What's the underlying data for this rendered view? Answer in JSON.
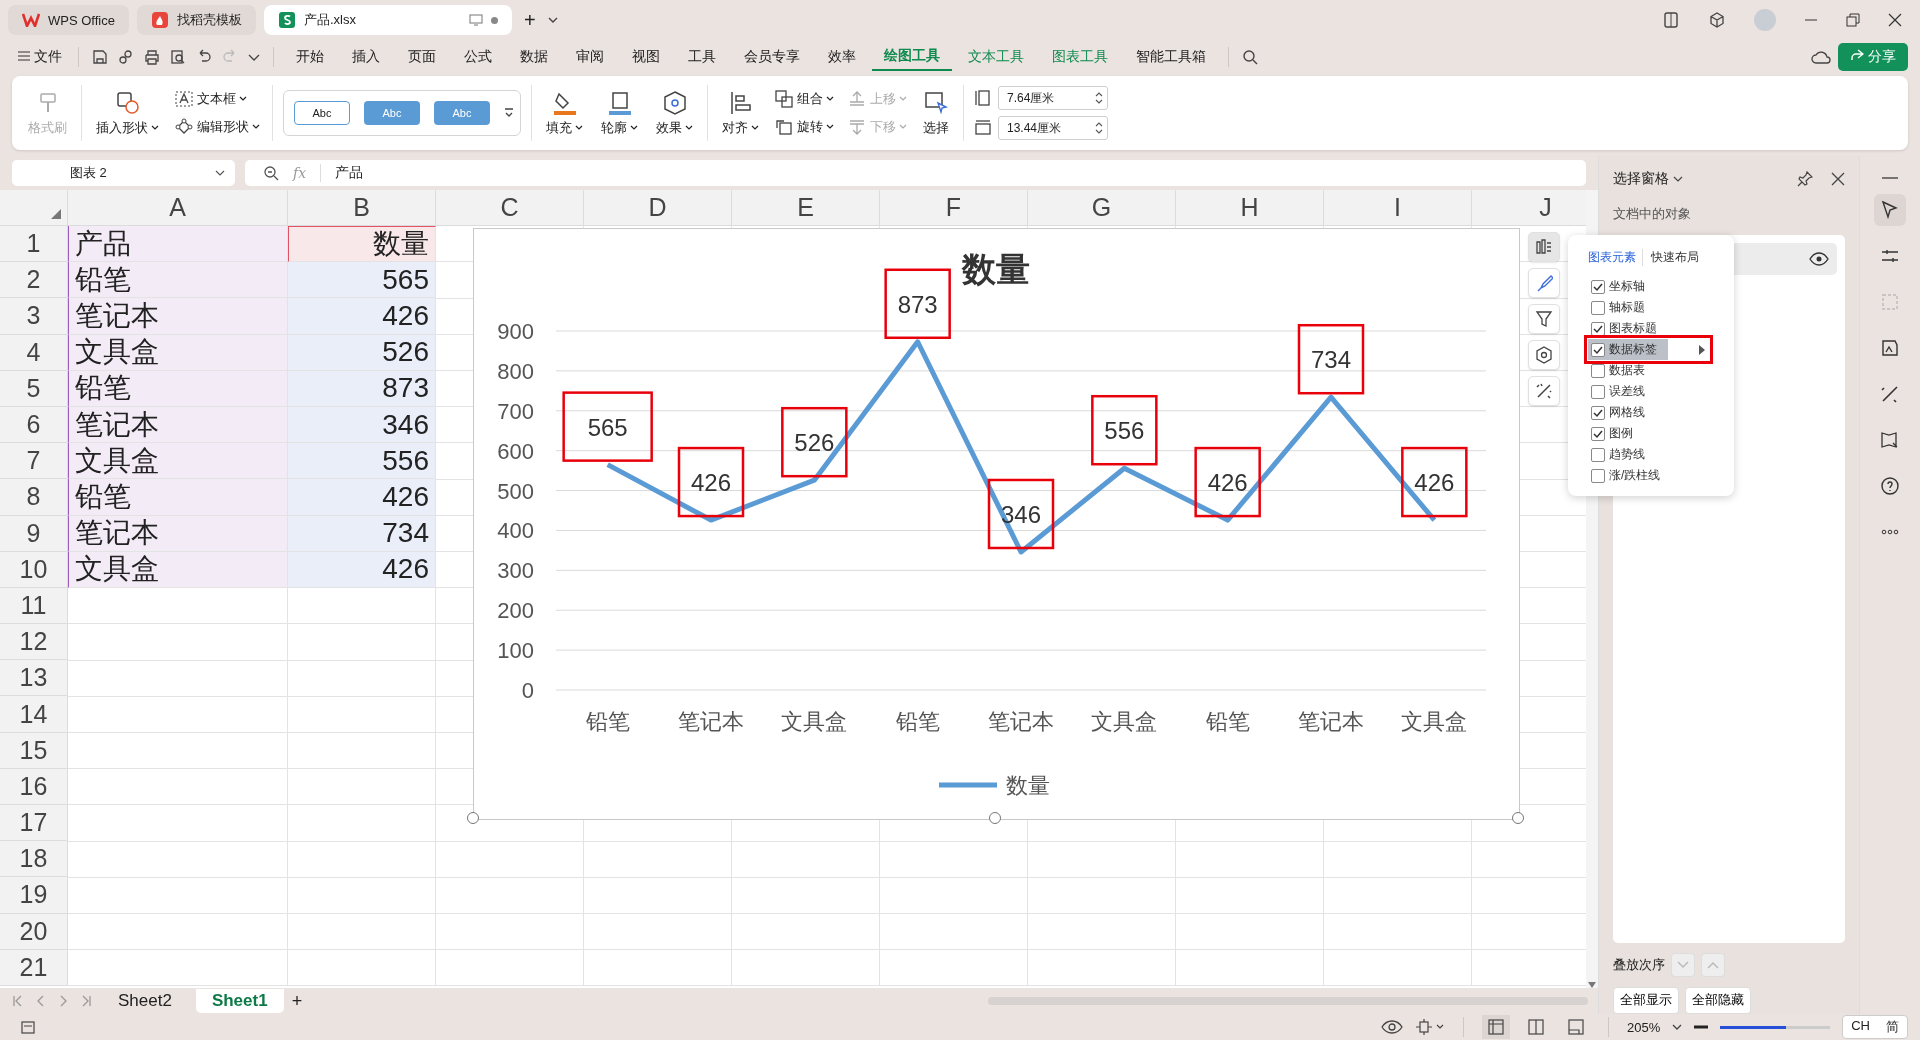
{
  "title_bar": {
    "tabs": [
      {
        "label": "WPS Office",
        "kind": "home",
        "selected": false
      },
      {
        "label": "找稻壳模板",
        "kind": "docer",
        "selected": false
      },
      {
        "label": "产品.xlsx",
        "kind": "sheet",
        "selected": true
      }
    ],
    "new_tab": "+"
  },
  "menu": {
    "file": "文件",
    "items": [
      {
        "label": "开始",
        "kind": "normal",
        "selected": false
      },
      {
        "label": "插入",
        "kind": "normal",
        "selected": false
      },
      {
        "label": "页面",
        "kind": "normal",
        "selected": false
      },
      {
        "label": "公式",
        "kind": "normal",
        "selected": false
      },
      {
        "label": "数据",
        "kind": "normal",
        "selected": false
      },
      {
        "label": "审阅",
        "kind": "normal",
        "selected": false
      },
      {
        "label": "视图",
        "kind": "normal",
        "selected": false
      },
      {
        "label": "工具",
        "kind": "normal",
        "selected": false
      },
      {
        "label": "会员专享",
        "kind": "normal",
        "selected": false
      },
      {
        "label": "效率",
        "kind": "normal",
        "selected": false
      },
      {
        "label": "绘图工具",
        "kind": "context",
        "selected": true
      },
      {
        "label": "文本工具",
        "kind": "context",
        "selected": false
      },
      {
        "label": "图表工具",
        "kind": "context",
        "selected": false
      },
      {
        "label": "智能工具箱",
        "kind": "normal",
        "selected": false
      }
    ],
    "share": "分享"
  },
  "ribbon": {
    "groups": [
      {
        "columns": [
          {
            "kind": "big",
            "buttons": [
              {
                "label": "格式刷",
                "dropdown": false,
                "disabled": true
              }
            ]
          }
        ]
      },
      {
        "columns": [
          {
            "kind": "big",
            "buttons": [
              {
                "label": "插入形状",
                "dropdown": true,
                "disabled": false
              }
            ]
          },
          {
            "kind": "stack",
            "buttons": [
              {
                "label": "文本框",
                "dropdown": true,
                "disabled": false
              },
              {
                "label": "编辑形状",
                "dropdown": true,
                "disabled": false
              }
            ]
          }
        ]
      },
      {
        "columns": [
          {
            "kind": "gallery",
            "styles": [
              {
                "label": "Abc",
                "kind": "outline"
              },
              {
                "label": "Abc",
                "kind": "filled"
              },
              {
                "label": "Abc",
                "kind": "filled"
              }
            ]
          }
        ]
      },
      {
        "columns": [
          {
            "kind": "big",
            "buttons": [
              {
                "label": "填充",
                "dropdown": true,
                "disabled": false
              }
            ]
          },
          {
            "kind": "big",
            "buttons": [
              {
                "label": "轮廓",
                "dropdown": true,
                "disabled": false
              }
            ]
          },
          {
            "kind": "big",
            "buttons": [
              {
                "label": "效果",
                "dropdown": true,
                "disabled": false
              }
            ]
          }
        ]
      },
      {
        "columns": [
          {
            "kind": "big",
            "buttons": [
              {
                "label": "对齐",
                "dropdown": true,
                "disabled": false
              }
            ]
          },
          {
            "kind": "stack",
            "buttons": [
              {
                "label": "组合",
                "dropdown": true,
                "disabled": false
              },
              {
                "label": "旋转",
                "dropdown": true,
                "disabled": false
              }
            ]
          },
          {
            "kind": "stack",
            "buttons": [
              {
                "label": "上移",
                "dropdown": true,
                "disabled": true
              },
              {
                "label": "下移",
                "dropdown": true,
                "disabled": true
              }
            ]
          },
          {
            "kind": "big",
            "buttons": [
              {
                "label": "选择",
                "dropdown": false,
                "disabled": false
              }
            ]
          }
        ]
      },
      {
        "columns": [
          {
            "kind": "size",
            "fields": [
              {
                "value": "7.64厘米"
              },
              {
                "value": "13.44厘米"
              }
            ]
          }
        ]
      }
    ]
  },
  "formula_bar": {
    "name_box": "图表 2",
    "fx": "fx",
    "value": "产品"
  },
  "sheet": {
    "columns": [
      "A",
      "B",
      "C",
      "D",
      "E",
      "F",
      "G",
      "H",
      "I",
      "J"
    ],
    "row_numbers": [
      "1",
      "2",
      "3",
      "4",
      "5",
      "6",
      "7",
      "8",
      "9",
      "10",
      "11",
      "12",
      "13",
      "14",
      "15",
      "16",
      "17",
      "18",
      "19",
      "20",
      "21"
    ],
    "highlighted_range": true,
    "rows": [
      [
        "产品",
        "数量"
      ],
      [
        "铅笔",
        "565"
      ],
      [
        "笔记本",
        "426"
      ],
      [
        "文具盒",
        "526"
      ],
      [
        "铅笔",
        "873"
      ],
      [
        "笔记本",
        "346"
      ],
      [
        "文具盒",
        "556"
      ],
      [
        "铅笔",
        "426"
      ],
      [
        "笔记本",
        "734"
      ],
      [
        "文具盒",
        "426"
      ]
    ]
  },
  "chart": {
    "boxed_labels": true,
    "chart_data": {
      "type": "line",
      "title": "数量",
      "categories": [
        "铅笔",
        "笔记本",
        "文具盒",
        "铅笔",
        "笔记本",
        "文具盒",
        "铅笔",
        "笔记本",
        "文具盒"
      ],
      "series": [
        {
          "name": "数量",
          "color": "#5b9bd5",
          "values": [
            565,
            426,
            526,
            873,
            346,
            556,
            426,
            734,
            426
          ]
        }
      ],
      "ylim": [
        0,
        900
      ],
      "grid": true,
      "yticks": [
        0,
        100,
        200,
        300,
        400,
        500,
        600,
        700,
        800,
        900
      ],
      "data_labels": true
    },
    "tools": [
      {
        "selected": true
      },
      {
        "selected": false
      },
      {
        "selected": false
      },
      {
        "selected": false
      },
      {
        "selected": false
      }
    ]
  },
  "elements_popup": {
    "tabs": [
      {
        "label": "图表元素",
        "selected": true
      },
      {
        "label": "快速布局",
        "selected": false
      }
    ],
    "items": [
      {
        "label": "坐标轴",
        "checked": true,
        "selected": false,
        "highlighted": false
      },
      {
        "label": "轴标题",
        "checked": false,
        "selected": false,
        "highlighted": false
      },
      {
        "label": "图表标题",
        "checked": true,
        "selected": false,
        "highlighted": false
      },
      {
        "label": "数据标签",
        "checked": true,
        "selected": true,
        "highlighted": true
      },
      {
        "label": "数据表",
        "checked": false,
        "selected": false,
        "highlighted": false
      },
      {
        "label": "误差线",
        "checked": false,
        "selected": false,
        "highlighted": false
      },
      {
        "label": "网格线",
        "checked": true,
        "selected": false,
        "highlighted": false
      },
      {
        "label": "图例",
        "checked": true,
        "selected": false,
        "highlighted": false
      },
      {
        "label": "趋势线",
        "checked": false,
        "selected": false,
        "highlighted": false
      },
      {
        "label": "涨/跌柱线",
        "checked": false,
        "selected": false,
        "highlighted": false
      }
    ]
  },
  "selection_pane": {
    "title": "选择窗格",
    "section": "文档中的对象",
    "objects": [
      {
        "selected": true,
        "visible": true
      }
    ],
    "order_label": "叠放次序",
    "buttons": [
      "全部显示",
      "全部隐藏"
    ]
  },
  "side_strip": [
    {
      "selected": true
    },
    {
      "selected": false
    },
    {
      "selected": false
    },
    {
      "selected": false
    },
    {
      "selected": false
    },
    {
      "selected": false
    },
    {
      "selected": false
    },
    {
      "selected": false
    }
  ],
  "sheet_tabs": [
    {
      "label": "Sheet2",
      "selected": false
    },
    {
      "label": "Sheet1",
      "selected": true
    }
  ],
  "add_sheet": "+",
  "status_bar": {
    "views": [
      {
        "selected": true
      },
      {
        "selected": false
      },
      {
        "selected": false
      }
    ],
    "zoom": "205%",
    "zoom_slider": {
      "level": 0.6
    },
    "ime": [
      "CH",
      "简"
    ]
  }
}
